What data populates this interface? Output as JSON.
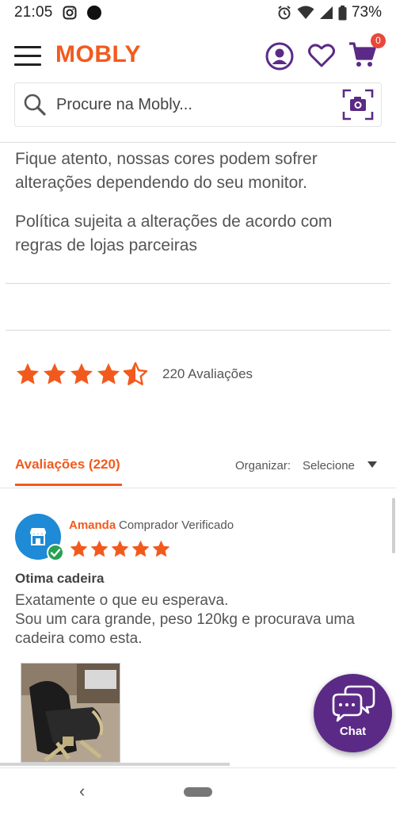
{
  "status_bar": {
    "time": "21:05",
    "battery": "73%"
  },
  "header": {
    "logo": "MOBLY",
    "cart_count": "0",
    "search": {
      "placeholder": "Procure na Mobly..."
    }
  },
  "info": {
    "paragraph_1": "Fique atento, nossas cores podem sofrer alterações dependendo do seu monitor.",
    "paragraph_2": "Política sujeita a alterações de acordo com regras de lojas parceiras"
  },
  "rating": {
    "stars": 4.5,
    "count_label": "220 Avaliações"
  },
  "reviews_tab": {
    "label": "Avaliações (220)",
    "sort_label": "Organizar:",
    "sort_value": "Selecione"
  },
  "review": {
    "author": "Amanda",
    "verified_label": "Comprador Verificado",
    "stars": 5,
    "title": "Otima cadeira",
    "body_line_1": "Exatamente o que eu esperava.",
    "body_line_2": "Sou um cara grande, peso 120kg e procurava uma cadeira como esta."
  },
  "chat": {
    "label": "Chat"
  },
  "colors": {
    "brand": "#f25a1d",
    "accent": "#5b2a86",
    "badge": "#e8473b",
    "verified": "#27a052"
  }
}
